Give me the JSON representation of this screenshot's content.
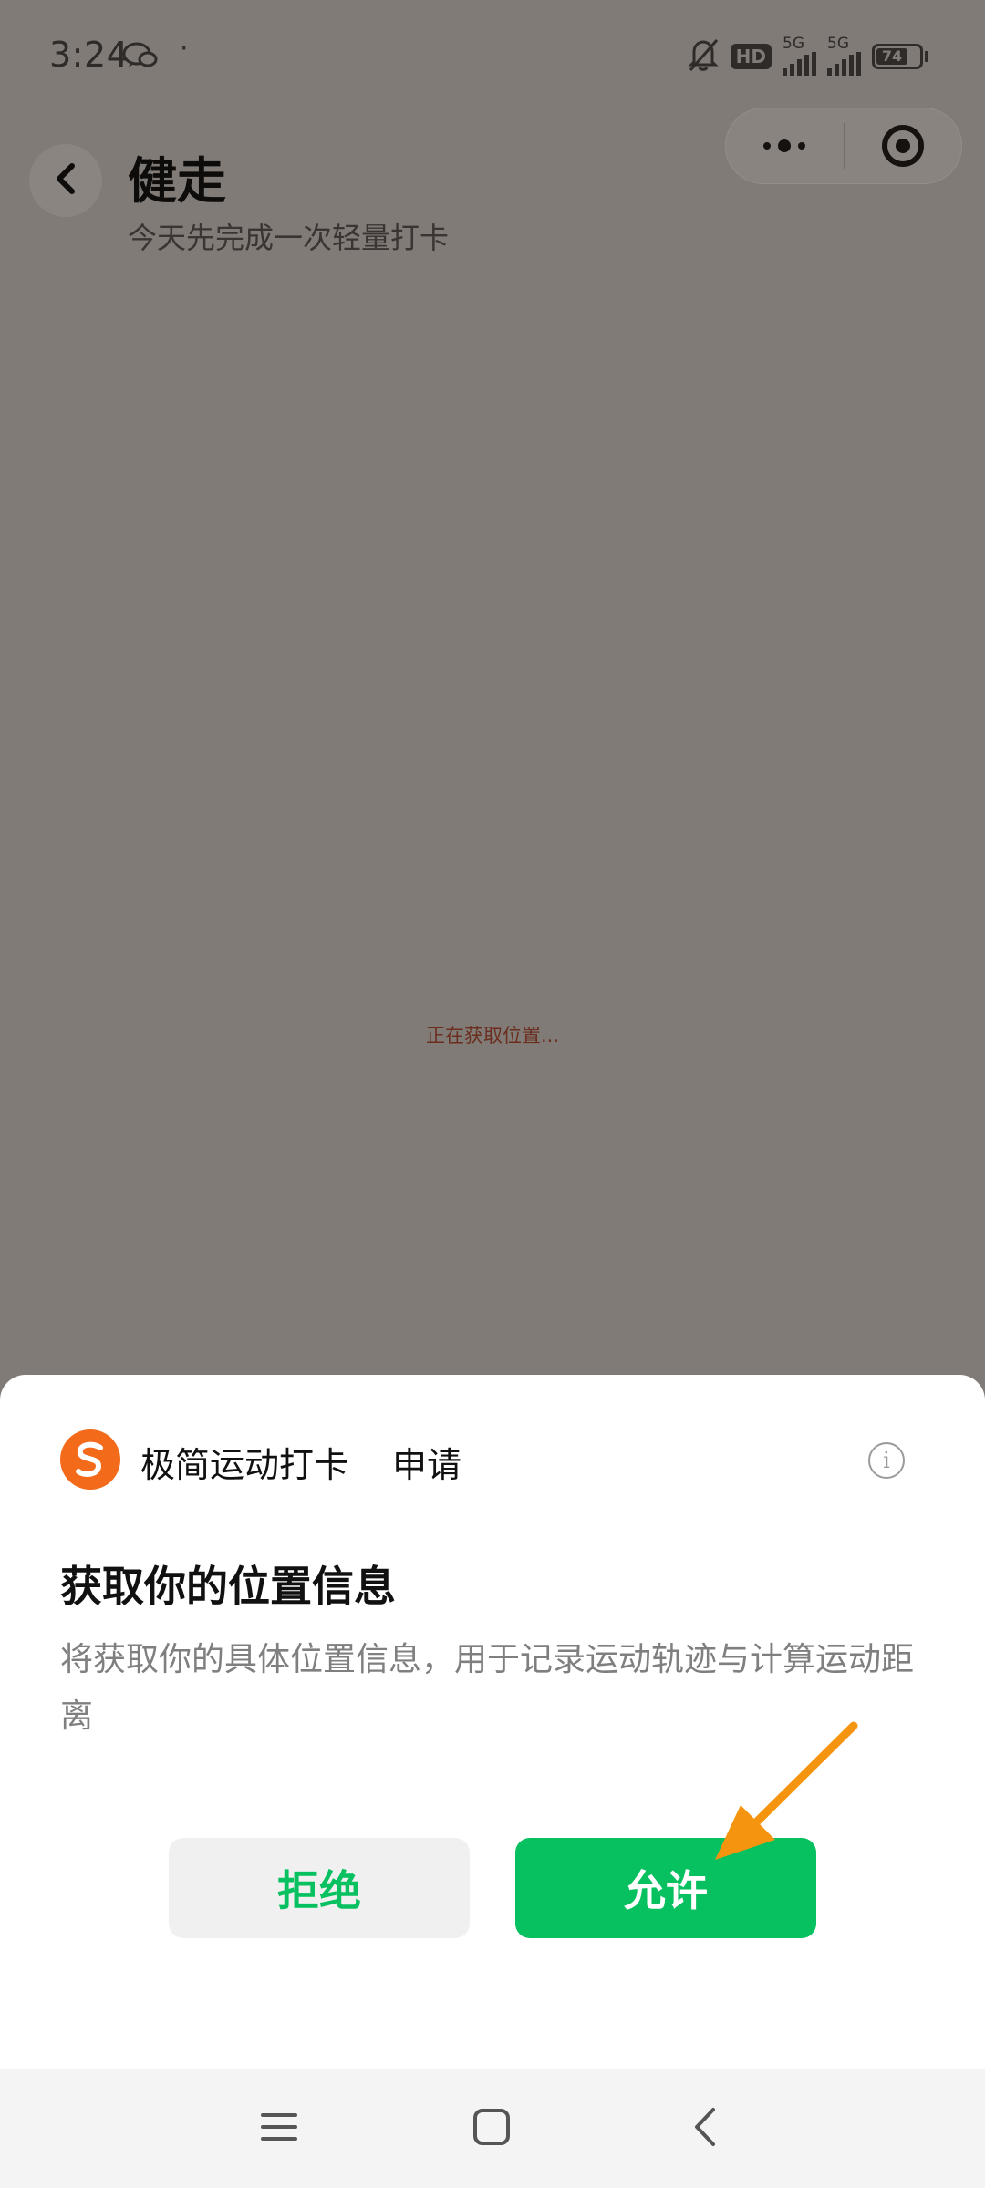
{
  "status_bar": {
    "time": "3:24",
    "dot": "·",
    "hd_label": "HD",
    "signal_label": "5G",
    "battery": "74"
  },
  "header": {
    "title": "健走",
    "subtitle": "今天先完成一次轻量打卡"
  },
  "main": {
    "loading_text": "正在获取位置..."
  },
  "dialog": {
    "app_name": "极简运动打卡",
    "apply_word": "申请",
    "title": "获取你的位置信息",
    "description": "将获取你的具体位置信息，用于记录运动轨迹与计算运动距离",
    "reject_label": "拒绝",
    "allow_label": "允许"
  },
  "colors": {
    "accent_green": "#07c160",
    "arrow_orange": "#f5950f",
    "logo_orange": "#f26a1a",
    "dim_overlay": "#817b77"
  },
  "icons": [
    "wechat-icon",
    "mute-bell-icon",
    "more-icon",
    "target-icon",
    "back-icon",
    "app-logo-icon",
    "info-icon",
    "menu-icon",
    "home-icon",
    "nav-back-icon"
  ]
}
